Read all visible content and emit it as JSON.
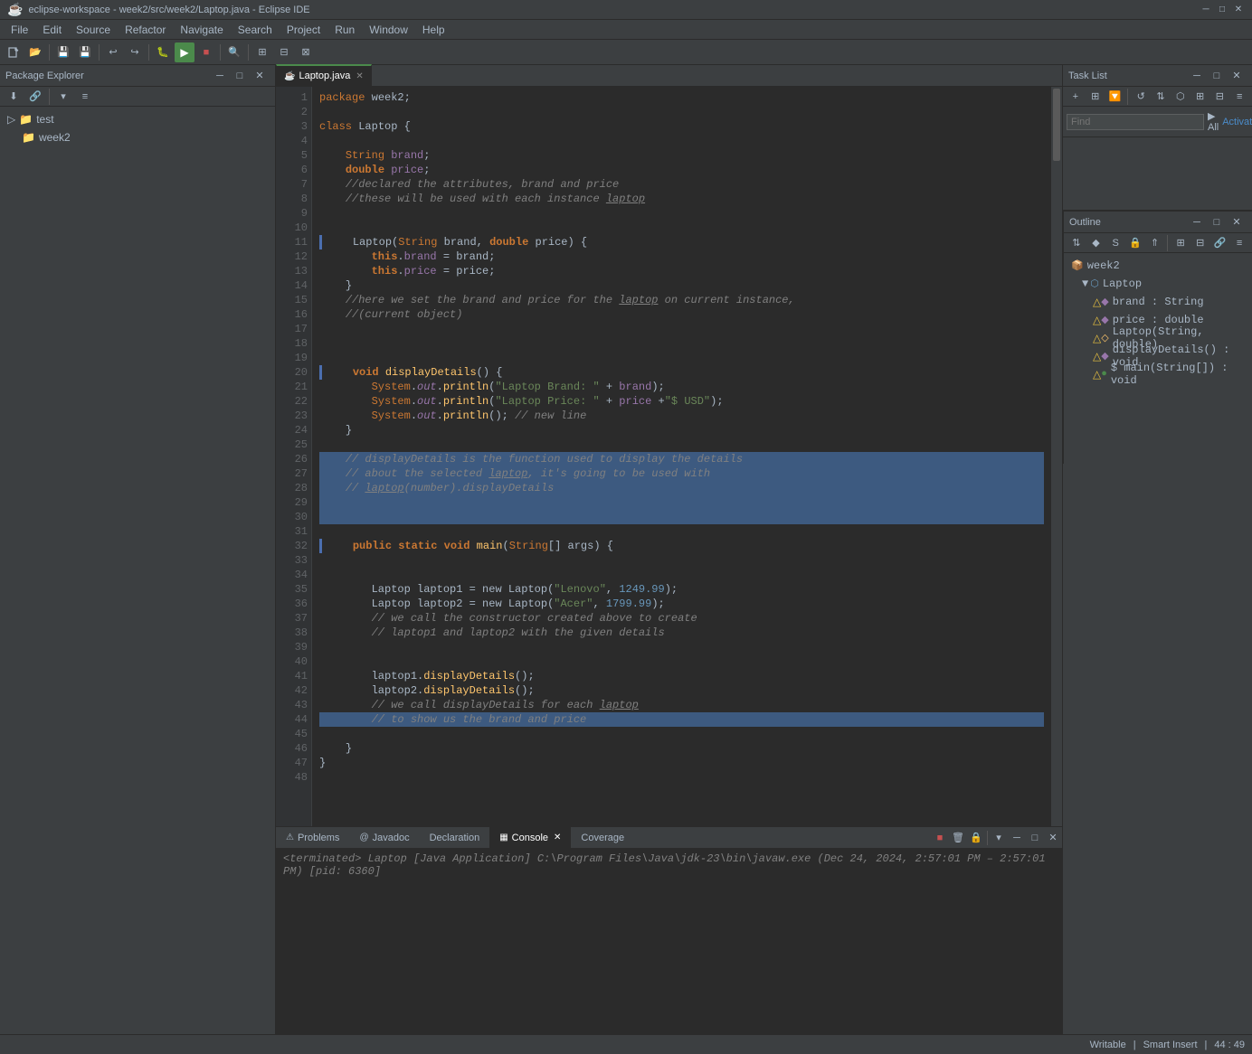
{
  "titleBar": {
    "icon": "☕",
    "title": "eclipse-workspace - week2/src/week2/Laptop.java - Eclipse IDE",
    "minimize": "─",
    "maximize": "□",
    "close": "✕"
  },
  "menuBar": {
    "items": [
      "File",
      "Edit",
      "Source",
      "Refactor",
      "Navigate",
      "Search",
      "Project",
      "Run",
      "Window",
      "Help"
    ]
  },
  "packageExplorer": {
    "title": "Package Explorer",
    "closeBtn": "✕",
    "items": [
      {
        "label": "test",
        "indent": 0,
        "icon": "📁",
        "expanded": true
      },
      {
        "label": "week2",
        "indent": 1,
        "icon": "📁",
        "expanded": false
      }
    ]
  },
  "editor": {
    "tab": {
      "label": "Laptop.java",
      "close": "✕",
      "active": true
    },
    "lines": [
      {
        "n": 1,
        "code": "<span class='kw'>package</span> <span class='normal'>week2;</span>"
      },
      {
        "n": 2,
        "code": ""
      },
      {
        "n": 3,
        "code": "<span class='kw'>class</span> <span class='cls'>Laptop</span> <span class='normal'>{</span>"
      },
      {
        "n": 4,
        "code": ""
      },
      {
        "n": 5,
        "code": "    <span class='type'>String</span> <span class='field'>brand</span><span class='normal'>;</span>"
      },
      {
        "n": 6,
        "code": "    <span class='kw2'>double</span> <span class='field'>price</span><span class='normal'>;</span>"
      },
      {
        "n": 7,
        "code": "    <span class='comment'>//declared the attributes, brand and price</span>"
      },
      {
        "n": 8,
        "code": "    <span class='comment'>//these will be used with each instance <span style='text-decoration:underline'>laptop</span></span>"
      },
      {
        "n": 9,
        "code": ""
      },
      {
        "n": 10,
        "code": ""
      },
      {
        "n": 11,
        "code": "    <span class='cls'>Laptop</span><span class='normal'>(</span><span class='type'>String</span> <span class='param'>brand</span><span class='normal'>,</span> <span class='kw2'>double</span> <span class='param'>price</span><span class='normal'>) {</span>",
        "mark": true
      },
      {
        "n": 12,
        "code": "        <span class='kw2'>this</span><span class='normal'>.</span><span class='field'>brand</span> <span class='normal'>= brand;</span>"
      },
      {
        "n": 13,
        "code": "        <span class='kw2'>this</span><span class='normal'>.</span><span class='field'>price</span> <span class='normal'>= price;</span>"
      },
      {
        "n": 14,
        "code": "    <span class='normal'>}</span>"
      },
      {
        "n": 15,
        "code": "    <span class='comment'>//here we set the brand and price for the <span style='text-decoration:underline'>laptop</span> on current instance,</span>"
      },
      {
        "n": 16,
        "code": "    <span class='comment'>//(current object)</span>"
      },
      {
        "n": 17,
        "code": ""
      },
      {
        "n": 18,
        "code": ""
      },
      {
        "n": 19,
        "code": ""
      },
      {
        "n": 20,
        "code": "    <span class='kw2'>void</span> <span class='fn'>displayDetails</span><span class='normal'>() {</span>",
        "mark": true
      },
      {
        "n": 21,
        "code": "        <span class='type'>System</span><span class='normal'>.</span><span class='static-field'>out</span><span class='normal'>.</span><span class='fn'>println</span><span class='normal'>(</span><span class='str'>\"Laptop Brand: \"</span> <span class='normal'>+</span> <span class='field'>brand</span><span class='normal'>);</span>"
      },
      {
        "n": 22,
        "code": "        <span class='type'>System</span><span class='normal'>.</span><span class='static-field'>out</span><span class='normal'>.</span><span class='fn'>println</span><span class='normal'>(</span><span class='str'>\"Laptop Price: \"</span> <span class='normal'>+</span> <span class='field'>price</span> <span class='normal'>+</span><span class='str'>\"$ USD\"</span><span class='normal'>);</span>"
      },
      {
        "n": 23,
        "code": "        <span class='type'>System</span><span class='normal'>.</span><span class='static-field'>out</span><span class='normal'>.</span><span class='fn'>println</span><span class='normal'>();</span> <span class='comment'>// new line</span>"
      },
      {
        "n": 24,
        "code": "    <span class='normal'>}</span>"
      },
      {
        "n": 25,
        "code": ""
      },
      {
        "n": 26,
        "code": "    <span class='comment'>// displayDetails is the function used to display the details</span>",
        "highlight": true
      },
      {
        "n": 27,
        "code": "    <span class='comment'>// about the selected <span style='text-decoration:underline'>laptop</span>, it's going to be used with</span>",
        "highlight": true
      },
      {
        "n": 28,
        "code": "    <span class='comment'>// <span style='text-decoration:underline'>laptop</span>(number).displayDetails</span>",
        "highlight": true
      },
      {
        "n": 29,
        "code": "",
        "highlight": true
      },
      {
        "n": 30,
        "code": "",
        "highlight": true
      },
      {
        "n": 31,
        "code": ""
      },
      {
        "n": 32,
        "code": "    <span class='kw2'>public</span> <span class='kw2'>static</span> <span class='kw2'>void</span> <span class='fn'>main</span><span class='normal'>(</span><span class='type'>String</span><span class='normal'>[]</span> <span class='param'>args</span><span class='normal'>) {</span>",
        "mark": true
      },
      {
        "n": 33,
        "code": ""
      },
      {
        "n": 34,
        "code": ""
      },
      {
        "n": 35,
        "code": "        <span class='cls'>Laptop</span> <span class='normal'>laptop1 = new</span> <span class='cls'>Laptop</span><span class='normal'>(</span><span class='str'>\"Lenovo\"</span><span class='normal'>,</span> <span class='num'>1249.99</span><span class='normal'>);</span>"
      },
      {
        "n": 36,
        "code": "        <span class='cls'>Laptop</span> <span class='normal'>laptop2 = new</span> <span class='cls'>Laptop</span><span class='normal'>(</span><span class='str'>\"Acer\"</span><span class='normal'>,</span> <span class='num'>1799.99</span><span class='normal'>);</span>"
      },
      {
        "n": 37,
        "code": "        <span class='comment'>// we call the constructor created above to create</span>"
      },
      {
        "n": 38,
        "code": "        <span class='comment'>// laptop1 and laptop2 with the given details</span>"
      },
      {
        "n": 39,
        "code": ""
      },
      {
        "n": 40,
        "code": ""
      },
      {
        "n": 41,
        "code": "        <span class='normal'>laptop1.</span><span class='fn'>displayDetails</span><span class='normal'>();</span>"
      },
      {
        "n": 42,
        "code": "        <span class='normal'>laptop2.</span><span class='fn'>displayDetails</span><span class='normal'>();</span>"
      },
      {
        "n": 43,
        "code": "        <span class='comment'>// we call displayDetails for each <span style='text-decoration:underline'>laptop</span></span>"
      },
      {
        "n": 44,
        "code": "        <span class='comment'>// to show us the brand and price</span>",
        "highlight": true
      },
      {
        "n": 45,
        "code": ""
      },
      {
        "n": 46,
        "code": "    <span class='normal'>}</span>"
      },
      {
        "n": 47,
        "code": "<span class='normal'>}</span>"
      },
      {
        "n": 48,
        "code": ""
      }
    ]
  },
  "taskList": {
    "title": "Task List",
    "close": "✕",
    "findPlaceholder": "Find",
    "allLabel": "▶ All",
    "activateLabel": "Activate..."
  },
  "outline": {
    "title": "Outline",
    "close": "✕",
    "items": [
      {
        "label": "week2",
        "indent": 0,
        "icon": "📦",
        "color": "pkg"
      },
      {
        "label": "Laptop",
        "indent": 1,
        "icon": "⬡",
        "color": "cls",
        "expand": true
      },
      {
        "label": "brand : String",
        "indent": 2,
        "icon": "◆",
        "color": "field"
      },
      {
        "label": "price : double",
        "indent": 2,
        "icon": "◆",
        "color": "field"
      },
      {
        "label": "Laptop(String, double)",
        "indent": 2,
        "icon": "◇",
        "color": "method"
      },
      {
        "label": "displayDetails() : void",
        "indent": 2,
        "icon": "◆",
        "color": "method"
      },
      {
        "label": "$ main(String[]) : void",
        "indent": 2,
        "icon": "●",
        "color": "method-main"
      }
    ]
  },
  "bottomTabs": {
    "tabs": [
      {
        "label": "Problems",
        "icon": "⚠",
        "active": false
      },
      {
        "label": "@ Javadoc",
        "icon": "",
        "active": false
      },
      {
        "label": "Declaration",
        "icon": "",
        "active": false
      },
      {
        "label": "Console",
        "icon": "▦",
        "active": true,
        "close": "✕"
      },
      {
        "label": "Coverage",
        "icon": "",
        "active": false
      }
    ]
  },
  "console": {
    "terminated": "<terminated> Laptop [Java Application] C:\\Program Files\\Java\\jdk-23\\bin\\javaw.exe (Dec 24, 2024, 2:57:01 PM – 2:57:01 PM) [pid: 6360]"
  },
  "statusBar": {
    "text": ""
  }
}
